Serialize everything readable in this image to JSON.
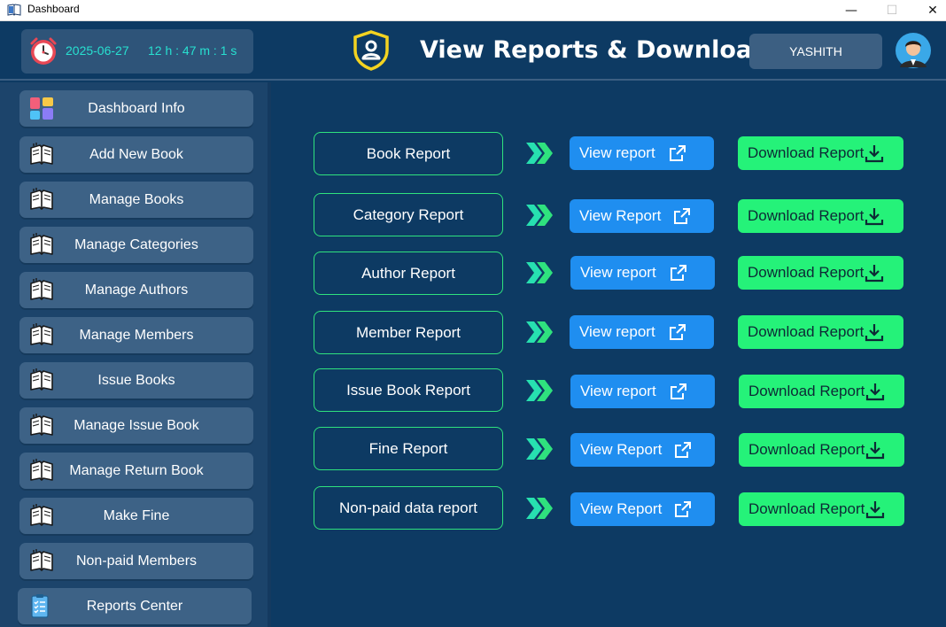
{
  "window": {
    "title": "Dashboard",
    "minimize": "—",
    "maximize": "☐",
    "close": "✕"
  },
  "header": {
    "date": "2025-06-27",
    "time": "12 h : 47 m : 1 s",
    "title": "View Reports & Download",
    "username": "YASHITH"
  },
  "sidebar": {
    "items": [
      {
        "label": "Dashboard Info",
        "icon": "dashboard-grid-icon"
      },
      {
        "label": "Add New Book",
        "icon": "open-book-icon"
      },
      {
        "label": "Manage Books",
        "icon": "open-book-icon"
      },
      {
        "label": "Manage Categories",
        "icon": "open-book-icon"
      },
      {
        "label": "Manage Authors",
        "icon": "open-book-icon"
      },
      {
        "label": "Manage Members",
        "icon": "open-book-icon"
      },
      {
        "label": "Issue Books",
        "icon": "open-book-icon"
      },
      {
        "label": "Manage Issue Book",
        "icon": "open-book-icon"
      },
      {
        "label": "Manage Return Book",
        "icon": "open-book-icon"
      },
      {
        "label": "Make Fine",
        "icon": "open-book-icon"
      },
      {
        "label": "Non-paid Members",
        "icon": "open-book-icon"
      },
      {
        "label": "Reports Center",
        "icon": "clipboard-checklist-icon"
      }
    ]
  },
  "reports": [
    {
      "label": "Book Report",
      "view": "View report",
      "download": "Download Report"
    },
    {
      "label": "Category Report",
      "view": "View Report",
      "download": "Download Report"
    },
    {
      "label": "Author Report",
      "view": "View report",
      "download": "Download Report"
    },
    {
      "label": "Member Report",
      "view": "View report",
      "download": "Download Report"
    },
    {
      "label": "Issue Book Report",
      "view": "View report",
      "download": "Download Report"
    },
    {
      "label": "Fine Report",
      "view": "View Report",
      "download": "Download Report"
    },
    {
      "label": "Non-paid data report",
      "view": "View Report",
      "download": "Download Report"
    }
  ],
  "colors": {
    "background": "#0d3a63",
    "sidebar": "#1c446b",
    "sidebar_button": "#3d6286",
    "accent_cyan": "#27e0d0",
    "view_button": "#1f8ef0",
    "download_button": "#25f279",
    "label_border": "#2fe27e"
  }
}
